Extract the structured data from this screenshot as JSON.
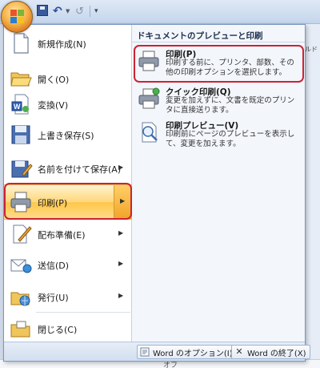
{
  "quick_access": {
    "undo_glyph": "↶",
    "redo_glyph": "↺",
    "more_glyph": "▾"
  },
  "left_menu": {
    "items": [
      {
        "label": "新規作成(N)",
        "arrow": false
      },
      {
        "label": "開く(O)",
        "arrow": false
      },
      {
        "label": "変換(V)",
        "arrow": false
      },
      {
        "label": "上書き保存(S)",
        "arrow": false
      },
      {
        "label": "名前を付けて保存(A)",
        "arrow": true
      },
      {
        "label": "印刷(P)",
        "arrow": true,
        "active": true
      },
      {
        "label": "配布準備(E)",
        "arrow": true
      },
      {
        "label": "送信(D)",
        "arrow": true
      },
      {
        "label": "発行(U)",
        "arrow": true
      },
      {
        "label": "閉じる(C)",
        "arrow": false
      }
    ],
    "arrow_glyph": "▶"
  },
  "right_pane": {
    "header": "ドキュメントのプレビューと印刷",
    "items": [
      {
        "title": "印刷(P)",
        "desc": "印刷する前に、プリンタ、部数、その他の印刷オプションを選択します。"
      },
      {
        "title": "クイック印刷(Q)",
        "desc": "変更を加えずに、文書を既定のプリンタに直接送ります。"
      },
      {
        "title": "印刷プレビュー(V)",
        "desc": "印刷前にページのプレビューを表示して、変更を加えます。"
      }
    ]
  },
  "footer": {
    "options_label": "Word のオプション(I)",
    "exit_label": "Word の終了(X)"
  },
  "background": {
    "right_fragment": "ルド",
    "bottom_fragment": "オフ"
  },
  "colors": {
    "highlight_red": "#cc2233",
    "active_orange": "#ffc64a",
    "menu_border": "#7a96c0"
  }
}
